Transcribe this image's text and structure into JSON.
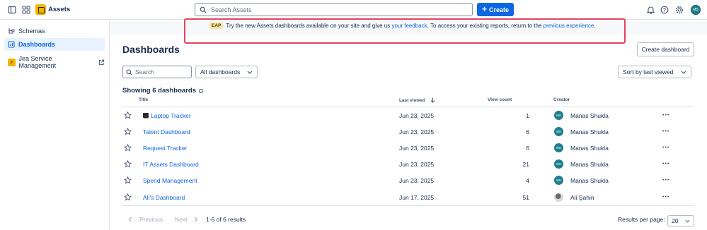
{
  "topbar": {
    "app_name": "Assets",
    "search_placeholder": "Search Assets",
    "create_label": "Create",
    "avatar_initials": "MS"
  },
  "sidebar": {
    "items": [
      {
        "label": "Schemas"
      },
      {
        "label": "Dashboards"
      },
      {
        "label": "Jira Service Management"
      }
    ]
  },
  "banner": {
    "badge": "EAP",
    "text_1": "Try the new Assets dashboards available on your site and give us",
    "link_1": "your feedback",
    "text_2": ". To access your existing reports, return to the",
    "link_2": "previous experience",
    "text_3": "."
  },
  "main": {
    "title": "Dashboards",
    "create_button": "Create dashboard",
    "search_placeholder": "Search",
    "filter_value": "All dashboards",
    "sort_value": "Sort by last viewed",
    "showing": "Showing 6 dashboards"
  },
  "table": {
    "headers": {
      "title": "Title",
      "last_viewed": "Last viewed",
      "view_count": "View count",
      "creator": "Creator"
    },
    "rows": [
      {
        "title": "Laptop Tracker",
        "has_emoji": true,
        "last_viewed": "Jun 23, 2025",
        "view_count": "1",
        "creator": "Manas Shukla",
        "creator_initials": "MS"
      },
      {
        "title": "Talent Dashboard",
        "last_viewed": "Jun 23, 2025",
        "view_count": "6",
        "creator": "Manas Shukla",
        "creator_initials": "MS"
      },
      {
        "title": "Request Tracker",
        "last_viewed": "Jun 23, 2025",
        "view_count": "6",
        "creator": "Manas Shukla",
        "creator_initials": "MS"
      },
      {
        "title": "IT Assets Dashboard",
        "last_viewed": "Jun 23, 2025",
        "view_count": "21",
        "creator": "Manas Shukla",
        "creator_initials": "MS"
      },
      {
        "title": "Spend Management",
        "last_viewed": "Jun 23, 2025",
        "view_count": "4",
        "creator": "Manas Shukla",
        "creator_initials": "MS"
      },
      {
        "title": "Ali's Dashboard",
        "last_viewed": "Jun 17, 2025",
        "view_count": "51",
        "creator": "Ali Şahin",
        "creator_initials": "",
        "photo": true
      }
    ]
  },
  "footer": {
    "previous": "Previous",
    "next": "Next",
    "results": "1-6 of 6 results",
    "rpp_label": "Results per page:",
    "rpp_value": "20"
  },
  "colors": {
    "accent": "#0c66e4",
    "banner_border": "#e2445c",
    "avatar": "#1d7f8c"
  }
}
